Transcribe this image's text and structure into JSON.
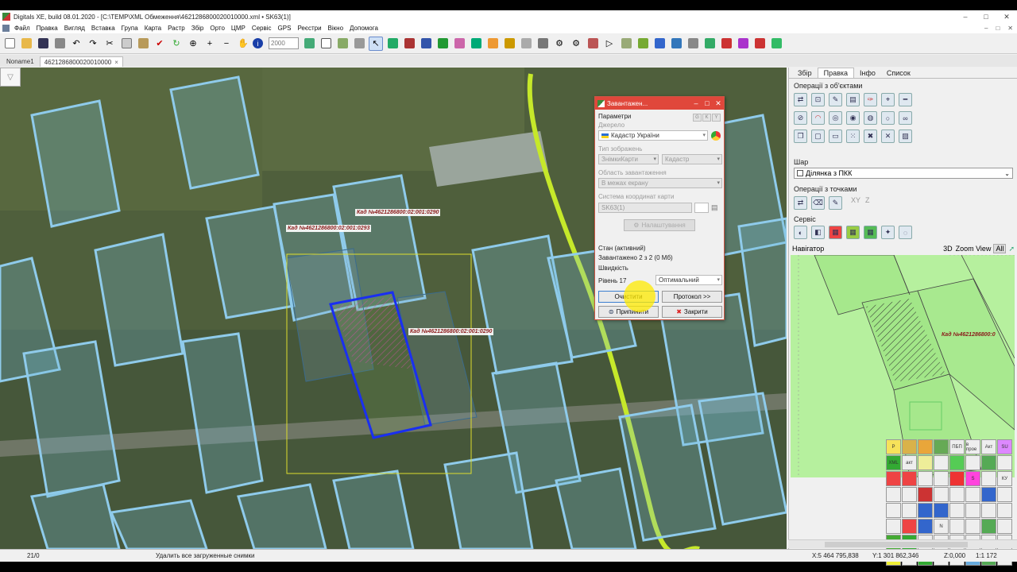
{
  "window": {
    "title": "Digitals XE, build 08.01.2020 - [C:\\TEMP\\XML Обмеження\\4621286800020010000.xml • SK63(1)]",
    "minimize": "–",
    "maximize": "□",
    "close": "✕"
  },
  "menu": [
    "Файл",
    "Правка",
    "Вигляд",
    "Вставка",
    "Група",
    "Карта",
    "Растр",
    "Збір",
    "Орто",
    "ЦМР",
    "Сервіс",
    "GPS",
    "Реєстри",
    "Вікно",
    "Допомога"
  ],
  "menu_right": [
    "–",
    "□",
    "✕"
  ],
  "toolbar": {
    "zoom_value": "2000"
  },
  "doc_tabs": [
    {
      "label": "Noname1",
      "active": false
    },
    {
      "label": "4621286800020010000",
      "active": true
    }
  ],
  "map": {
    "labels": [
      "Кад №4621286800:02:001:0290",
      "Кад №4621286800:02:001:0293",
      "Кад №4621286800:02:001:0290"
    ]
  },
  "dialog": {
    "title": "Завантажен...",
    "params_label": "Параметри",
    "mini_tabs": [
      "G",
      "K",
      "Y"
    ],
    "source_label": "Джерело",
    "source_value": "Кадастр України",
    "image_type_label": "Тип зображень",
    "image_type_value": "ЗнімкиКарти",
    "image_type_value2": "Кадастр",
    "area_label": "Область завантаження",
    "area_value": "В межах екрану",
    "crs_label": "Система координат карти",
    "crs_value": "SK63(1)",
    "settings_button": "Налаштування",
    "state_label": "Стан (активний)",
    "loaded_text": "Завантажено 2 з 2 (0 Mб)",
    "speed_label": "Швидкість",
    "level_label": "Рівень 17",
    "level_mode": "Оптимальний",
    "clear_button": "Очистити",
    "protocol_button": "Протокол >>",
    "stop_button": "Припинити",
    "close_button": "Закрити"
  },
  "right_panel": {
    "tabs": [
      {
        "label": "Збір",
        "active": false
      },
      {
        "label": "Правка",
        "active": true
      },
      {
        "label": "Інфо",
        "active": false
      },
      {
        "label": "Список",
        "active": false
      }
    ],
    "ops_objects_label": "Операції з об'єктами",
    "layer_label": "Шар",
    "layer_value": "Ділянка з ПКК",
    "ops_points_label": "Операції з точками",
    "points_xy": "XY",
    "points_z": "Z",
    "service_label": "Сервіс",
    "navigator_label": "Навігатор",
    "nav_3d": "3D",
    "nav_zoom": "Zoom View",
    "nav_all": "All",
    "nav_parcel_label": "Кад №4621286800:0",
    "palette": [
      "P",
      "",
      "",
      "",
      "ПБП",
      "в прое",
      "Акт",
      "SU",
      "XML",
      "акт",
      "",
      "",
      "",
      "",
      "",
      "",
      "",
      "",
      "",
      "",
      "",
      "S",
      "",
      "КУ",
      "",
      "",
      "",
      "",
      "",
      "",
      "",
      "",
      "",
      "",
      "",
      "",
      "",
      "",
      "",
      "",
      "",
      "",
      "",
      "N",
      "",
      "",
      "",
      "",
      "",
      "",
      "",
      "",
      "",
      "",
      "",
      "",
      "",
      "",
      "",
      "",
      "",
      "",
      "",
      ""
    ]
  },
  "status": {
    "count": "21/0",
    "message": "Удалить все загруженные снимки",
    "x": "X:5 464 795,838",
    "y": "Y:1 301 862,346",
    "z": "Z:0,000",
    "scale": "1:1 172"
  }
}
